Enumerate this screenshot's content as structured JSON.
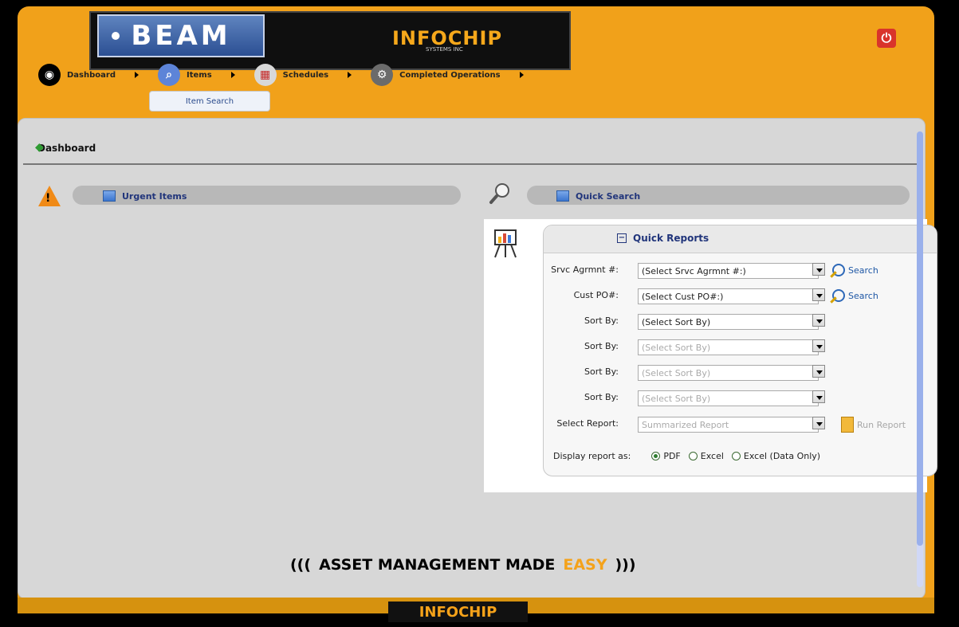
{
  "header": {
    "app_logo": "BEAM",
    "brand": "INFOCHIP",
    "brand_sub": "SYSTEMS INC",
    "user_info": "",
    "power_icon": "power-icon"
  },
  "nav": {
    "items": [
      {
        "label": "Dashboard",
        "icon": "dashboard-icon"
      },
      {
        "label": "Items",
        "icon": "search-icon"
      },
      {
        "label": "Schedules",
        "icon": "calendar-icon"
      },
      {
        "label": "Completed Operations",
        "icon": "operations-icon"
      }
    ],
    "sub": {
      "label": "Item Search"
    }
  },
  "page": {
    "title": "Dashboard",
    "right_text": "",
    "left_panel": {
      "label": "Urgent Items"
    },
    "right_panel": {
      "label": "Quick Search"
    }
  },
  "quick_reports": {
    "title": "Quick Reports",
    "rows": [
      {
        "label": "Srvc Agrmnt #:",
        "value": "(Select Srvc Agrmnt #:)",
        "has_search": true
      },
      {
        "label": "Cust PO#:",
        "value": "(Select Cust PO#:)",
        "has_search": true
      },
      {
        "label": "Sort By:",
        "value": "(Select Sort By)",
        "has_search": false
      },
      {
        "label": "Sort By:",
        "value": "(Select Sort By)",
        "has_search": false
      },
      {
        "label": "Sort By:",
        "value": "(Select Sort By)",
        "has_search": false
      },
      {
        "label": "Sort By:",
        "value": "(Select Sort By)",
        "has_search": false
      }
    ],
    "search_label": "Search",
    "select_report": {
      "label": "Select Report:",
      "value": "Summarized Report"
    },
    "run_report": "Run Report",
    "display_as": {
      "label": "Display report as:",
      "options": [
        "PDF",
        "Excel",
        "Excel (Data Only)"
      ],
      "selected": "PDF"
    }
  },
  "tagline": {
    "part1": "((( ",
    "part2": "ASSET MANAGEMENT MADE ",
    "accent": "EASY",
    "part3": " )))"
  },
  "footer": {
    "brand": "INFOCHIP"
  },
  "colors": {
    "frame": "#f1a11a",
    "content": "#d7d7d7",
    "link": "#1e57a5",
    "title": "#21357b"
  }
}
